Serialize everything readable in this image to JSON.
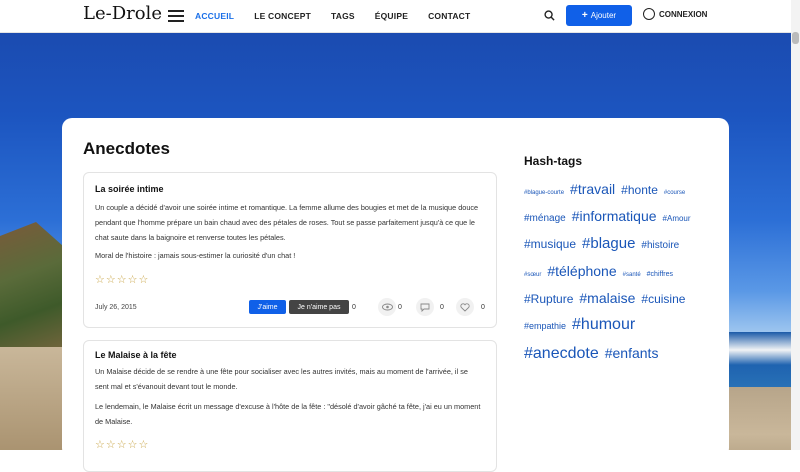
{
  "nav": {
    "logo": "Le-Drole",
    "menu": [
      {
        "label": "ACCUEIL",
        "active": true
      },
      {
        "label": "LE CONCEPT",
        "active": false
      },
      {
        "label": "TAGS",
        "active": false
      },
      {
        "label": "ÉQUIPE",
        "active": false
      },
      {
        "label": "CONTACT",
        "active": false
      }
    ],
    "add_label": "Ajouter",
    "login_label": "CONNEXION"
  },
  "main": {
    "title": "Anecdotes",
    "cards": [
      {
        "title": "La soirée intime",
        "paragraph1": "Un couple a décidé d'avoir une soirée intime et romantique. La femme allume des bougies et met de la musique douce pendant que l'homme prépare un bain chaud avec des pétales de roses. Tout se passe parfaitement jusqu'à ce que le chat saute dans la baignoire et renverse toutes les pétales.",
        "paragraph2": "Moral de l'histoire : jamais sous-estimer la curiosité d'un chat !",
        "stars": "☆☆☆☆☆",
        "date": "July 26, 2015",
        "like_label": "J'aime",
        "dislike_label": "Je n'aime pas",
        "dislike_count": "0",
        "views_count": "0",
        "comments_count": "0",
        "hearts_count": "0"
      },
      {
        "title": "Le Malaise à la fête",
        "paragraph1": "Un Malaise décide de se rendre à une fête pour socialiser avec les autres invités, mais au moment de l'arrivée, il se sent mal et s'évanouit devant tout le monde.",
        "paragraph2": "Le lendemain, le Malaise écrit un message d'excuse à l'hôte de la fête : \"désolé d'avoir gâché ta fête, j'ai eu un moment de Malaise.",
        "stars": "☆☆☆☆☆"
      }
    ]
  },
  "sidebar": {
    "title": "Hash-tags",
    "tags": [
      {
        "label": "#blague-courte",
        "size": 6
      },
      {
        "label": "#travail",
        "size": 14
      },
      {
        "label": "#honte",
        "size": 12
      },
      {
        "label": "#course",
        "size": 6
      },
      {
        "label": "#ménage",
        "size": 10
      },
      {
        "label": "#informatique",
        "size": 14
      },
      {
        "label": "#Amour",
        "size": 8
      },
      {
        "label": "#musique",
        "size": 12
      },
      {
        "label": "#blague",
        "size": 15
      },
      {
        "label": "#histoire",
        "size": 10
      },
      {
        "label": "#sœur",
        "size": 6
      },
      {
        "label": "#téléphone",
        "size": 14
      },
      {
        "label": "#santé",
        "size": 6
      },
      {
        "label": "#chiffres",
        "size": 7
      },
      {
        "label": "#Rupture",
        "size": 12
      },
      {
        "label": "#malaise",
        "size": 14
      },
      {
        "label": "#cuisine",
        "size": 12
      },
      {
        "label": "#empathie",
        "size": 9
      },
      {
        "label": "#humour",
        "size": 16
      },
      {
        "label": "#anecdote",
        "size": 16
      },
      {
        "label": "#enfants",
        "size": 14
      }
    ]
  }
}
